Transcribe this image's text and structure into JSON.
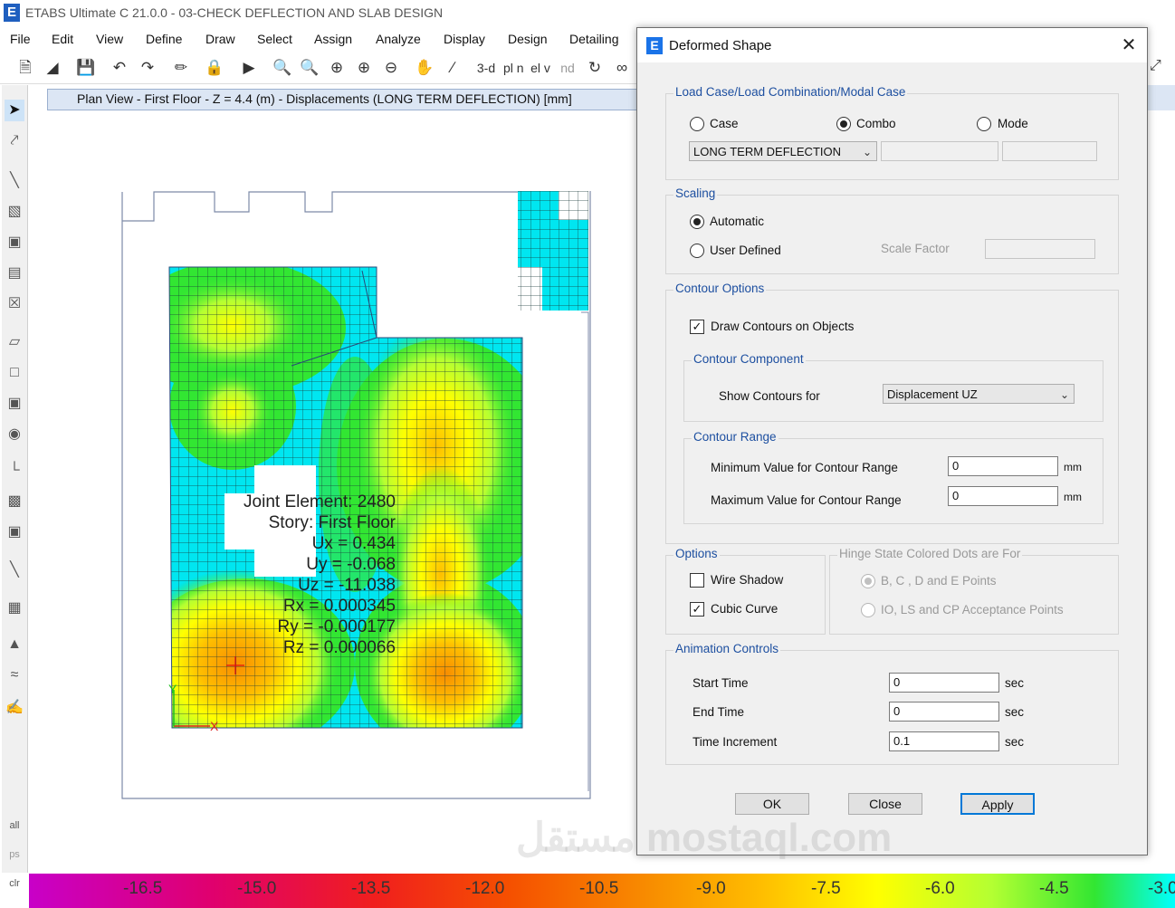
{
  "app": {
    "icon_letter": "E",
    "title": "ETABS Ultimate C 21.0.0 - 03-CHECK DEFLECTION AND SLAB DESIGN"
  },
  "menu": [
    "File",
    "Edit",
    "View",
    "Define",
    "Draw",
    "Select",
    "Assign",
    "Analyze",
    "Display",
    "Design",
    "Detailing"
  ],
  "toolbar": {
    "icons": [
      "new-file-icon",
      "open-folder-icon",
      "save-icon",
      "undo-icon",
      "redo-icon",
      "pencil-icon",
      "lock-icon",
      "run-icon",
      "zoom-window-icon",
      "zoom-fit-icon",
      "zoom-in-icon",
      "zoom-in-step-icon",
      "zoom-out-icon",
      "pan-icon",
      "rubber-band-icon"
    ],
    "view_3d": "3-d",
    "view_plan": "pl n",
    "view_elev": "el v",
    "view_nd": "nd"
  },
  "left_tools": [
    "pointer-icon",
    "reshape-icon",
    "draw-line-icon",
    "draw-brace-icon",
    "draw-column-icon",
    "draw-beam-icon",
    "draw-grid-icon",
    "draw-floor-icon",
    "draw-rect-icon",
    "draw-opening-icon",
    "draw-wall-icon",
    "quick-wall-icon",
    "draw-link-icon",
    "draw-tendon-icon",
    "draw-grid-system-icon",
    "draw-dimension-icon",
    "draw-spring-icon",
    "draw-reference-icon"
  ],
  "left_bottom": [
    "all",
    "ps",
    "clr"
  ],
  "view": {
    "title": "Plan View - First Floor - Z = 4.4 (m)   - Displacements (LONG TERM DEFLECTION)  [mm]"
  },
  "joint_info": {
    "line1": "Joint Element: 2480",
    "line2": "Story: First Floor",
    "ux": "Ux =  0.434",
    "uy": "Uy =  -0.068",
    "uz": "Uz =  -11.038",
    "rx": "Rx =  0.000345",
    "ry": "Ry =  -0.000177",
    "rz": "Rz =  0.000066"
  },
  "axes": {
    "x": "X",
    "y": "Y"
  },
  "color_scale": {
    "labels": [
      "-16.5",
      "-15.0",
      "-13.5",
      "-12.0",
      "-10.5",
      "-9.0",
      "-7.5",
      "-6.0",
      "-4.5",
      "-3.0"
    ],
    "colors": [
      "#c800c8",
      "#e0006e",
      "#f01e1e",
      "#f55000",
      "#f88c00",
      "#ffbe00",
      "#ffff00",
      "#b4ff32",
      "#32e632",
      "#00ffff"
    ]
  },
  "dialog": {
    "icon_letter": "E",
    "title": "Deformed Shape",
    "load_group": {
      "label": "Load Case/Load Combination/Modal Case",
      "case": "Case",
      "combo": "Combo",
      "mode": "Mode",
      "selected": "combo",
      "value": "LONG TERM DEFLECTION"
    },
    "scaling": {
      "label": "Scaling",
      "automatic": "Automatic",
      "user_defined": "User Defined",
      "scale_factor": "Scale Factor",
      "selected": "automatic"
    },
    "contour_options": {
      "label": "Contour Options",
      "draw_contours": "Draw Contours on Objects",
      "draw_contours_checked": true,
      "component_label": "Contour Component",
      "show_for": "Show Contours for",
      "component_value": "Displacement UZ",
      "range_label": "Contour Range",
      "min_label": "Minimum Value for Contour Range",
      "min_value": "0",
      "max_label": "Maximum Value for Contour Range",
      "max_value": "0",
      "unit": "mm"
    },
    "options": {
      "label": "Options",
      "wire_shadow": "Wire Shadow",
      "wire_shadow_checked": false,
      "cubic_curve": "Cubic Curve",
      "cubic_curve_checked": true
    },
    "hinge": {
      "label": "Hinge State Colored Dots are For",
      "opt1": "B, C , D and E Points",
      "opt2": "IO, LS and CP Acceptance Points"
    },
    "animation": {
      "label": "Animation Controls",
      "start": "Start Time",
      "start_value": "0",
      "end": "End Time",
      "end_value": "0",
      "increment": "Time Increment",
      "increment_value": "0.1",
      "unit": "sec"
    },
    "buttons": {
      "ok": "OK",
      "close": "Close",
      "apply": "Apply"
    }
  },
  "watermark": "مستقل mostaql.com"
}
